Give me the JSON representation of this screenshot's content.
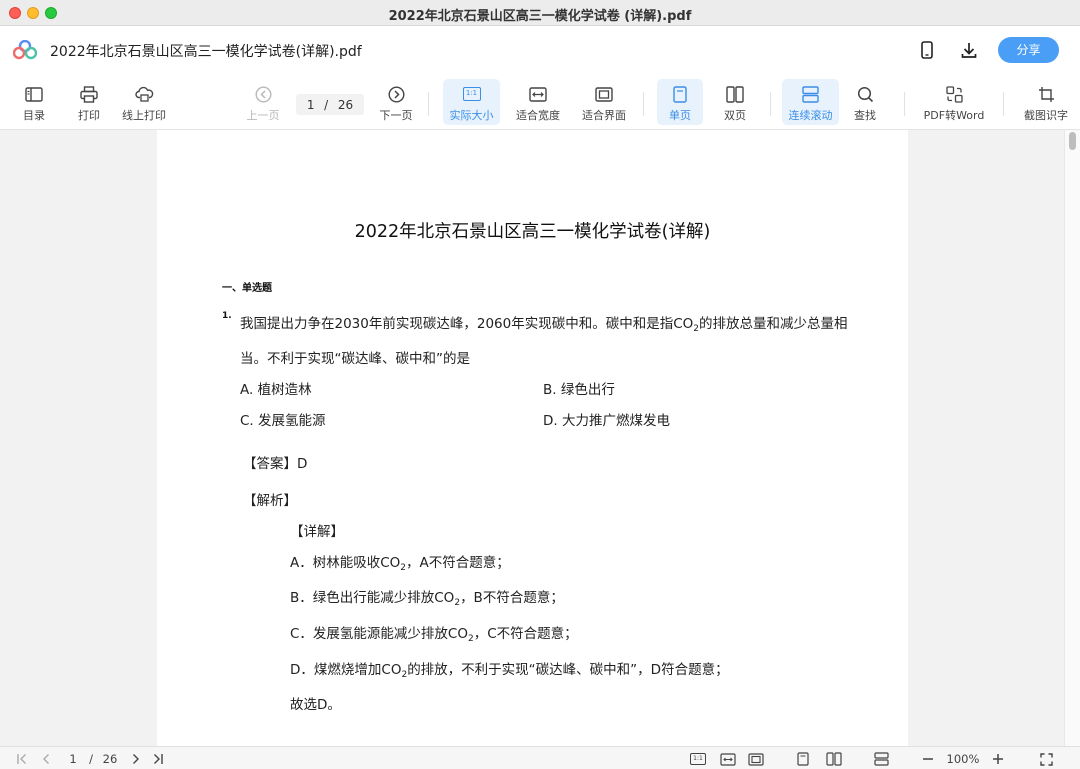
{
  "window": {
    "title": "2022年北京石景山区高三一模化学试卷 (详解).pdf"
  },
  "header": {
    "doc_title": "2022年北京石景山区高三一模化学试卷(详解).pdf",
    "share_label": "分享"
  },
  "toolbar": {
    "toc": "目录",
    "print": "打印",
    "online_print": "线上打印",
    "prev_page": "上一页",
    "current_page": "1",
    "separator": "/",
    "total_pages": "26",
    "next_page": "下一页",
    "actual_size_icon_text": "1:1",
    "actual_size": "实际大小",
    "fit_width": "适合宽度",
    "fit_page": "适合界面",
    "single_page": "单页",
    "double_page": "双页",
    "continuous_scroll": "连续滚动",
    "search": "查找",
    "pdf_to_word": "PDF转Word",
    "ocr": "截图识字"
  },
  "document": {
    "title": "2022年北京石景山区高三一模化学试卷(详解)",
    "section": "一、单选题",
    "q_num": "1.",
    "q_line1_a": "我国提出力争在2030年前实现碳达峰，2060年实现碳中和。碳中和是指CO",
    "q_line1_sub": "2",
    "q_line1_b": "的排放总量和减少总量相",
    "q_line2": "当。不利于实现“碳达峰、碳中和”的是",
    "opt_a": "A. 植树造林",
    "opt_b": "B. 绿色出行",
    "opt_c": "C. 发展氢能源",
    "opt_d": "D. 大力推广燃煤发电",
    "answer": "【答案】D",
    "analysis": "【解析】",
    "detail": "【详解】",
    "expl_a_1": "A．树林能吸收CO",
    "expl_a_sub": "2",
    "expl_a_2": "，A不符合题意；",
    "expl_b_1": "B．绿色出行能减少排放CO",
    "expl_b_sub": "2",
    "expl_b_2": "，B不符合题意；",
    "expl_c_1": "C．发展氢能源能减少排放CO",
    "expl_c_sub": "2",
    "expl_c_2": "，C不符合题意；",
    "expl_d_1": "D．煤燃烧增加CO",
    "expl_d_sub": "2",
    "expl_d_2": "的排放，不利于实现“碳达峰、碳中和”，D符合题意；",
    "conclusion": "故选D。"
  },
  "statusbar": {
    "current_page": "1",
    "separator": "/",
    "total_pages": "26",
    "actual_size_icon_text": "1:1",
    "zoom": "100%"
  },
  "colors": {
    "accent": "#4a9ef5",
    "active_bg": "#e8f2fd",
    "active_text": "#3a8ee6"
  }
}
